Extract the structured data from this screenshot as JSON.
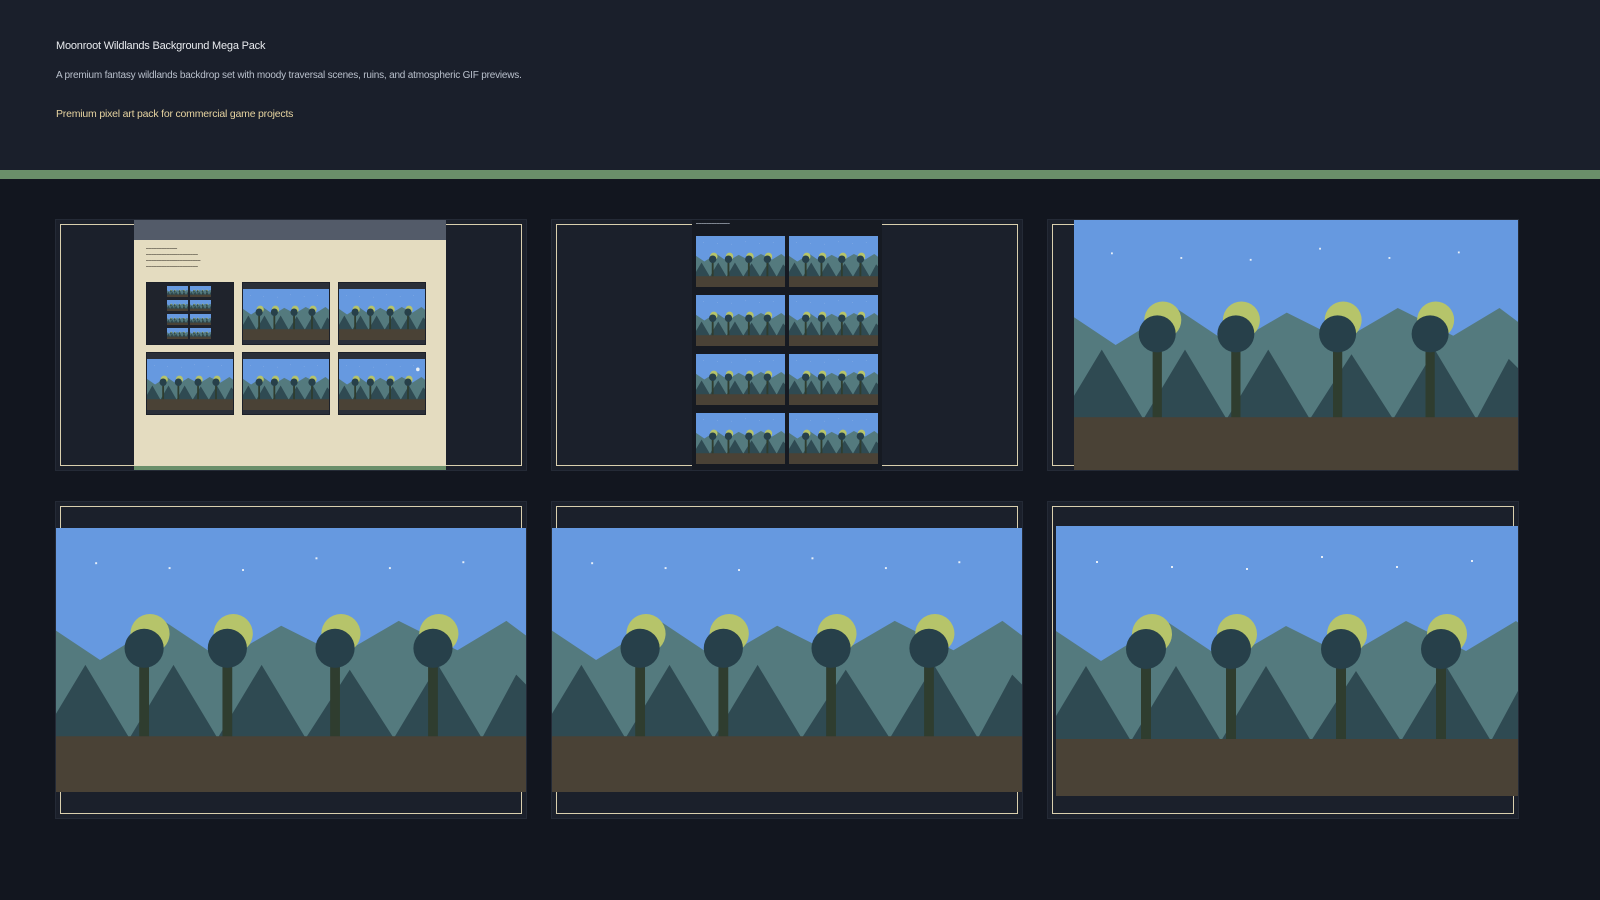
{
  "header": {
    "title": "Moonroot Wildlands Background Mega Pack",
    "description": "A premium fantasy wildlands backdrop set with moody traversal scenes, ruins, and atmospheric GIF previews.",
    "tagline": "Premium pixel art pack for commercial game projects"
  },
  "colors": {
    "background": "#12161f",
    "header": "#1a1f2b",
    "accent_stripe": "#6a8f6a",
    "tagline": "#e6d3a0",
    "frame": "#d9cfae",
    "sky": "#6699e0",
    "ground": "#4a4236",
    "tree_trunk": "#2f3d2f",
    "tree_canopy": "#27404a",
    "moon_glow": "#b6c46a"
  },
  "gallery": {
    "tiles": [
      {
        "kind": "store-page-preview"
      },
      {
        "kind": "thumbnail-sheet-preview"
      },
      {
        "kind": "scene-preview"
      },
      {
        "kind": "scene-preview"
      },
      {
        "kind": "scene-preview"
      },
      {
        "kind": "scene-preview"
      }
    ]
  }
}
